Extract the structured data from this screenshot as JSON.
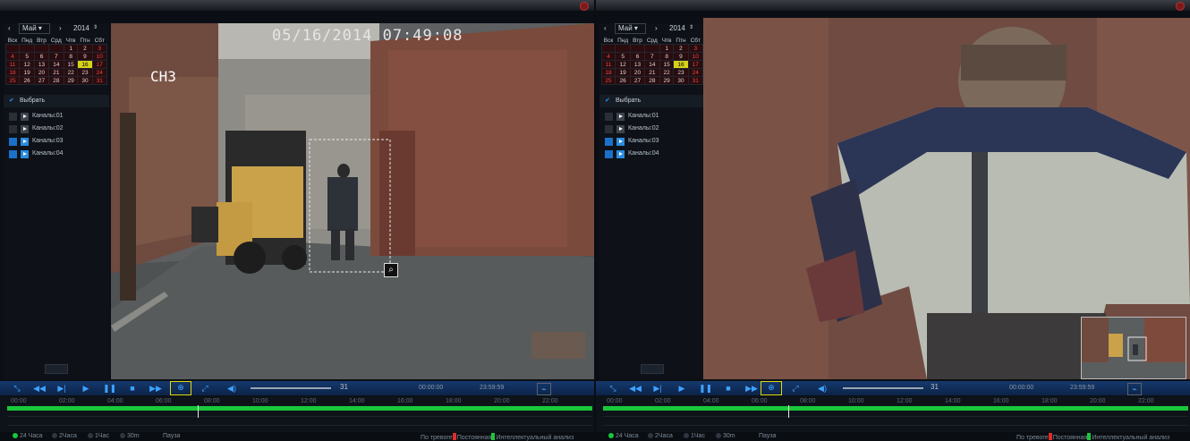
{
  "panes": [
    {
      "calendar": {
        "month": "Май",
        "year": "2014",
        "weekdays": [
          "Вск",
          "Пнд",
          "Втр",
          "Срд",
          "Чтв",
          "Птн",
          "Сбт"
        ],
        "weeks": [
          [
            "",
            "",
            "",
            "",
            "1",
            "2",
            "3"
          ],
          [
            "4",
            "5",
            "6",
            "7",
            "8",
            "9",
            "10"
          ],
          [
            "11",
            "12",
            "13",
            "14",
            "15",
            "16",
            "17"
          ],
          [
            "18",
            "19",
            "20",
            "21",
            "22",
            "23",
            "24"
          ],
          [
            "25",
            "26",
            "27",
            "28",
            "29",
            "30",
            "31"
          ]
        ],
        "selected_day": "16"
      },
      "select_label": "Выбрать",
      "channels": [
        {
          "label": "Каналы:01",
          "checked": false
        },
        {
          "label": "Каналы:02",
          "checked": false
        },
        {
          "label": "Каналы:03",
          "checked": true
        },
        {
          "label": "Каналы:04",
          "checked": true
        }
      ],
      "video": {
        "timestamp": "05/16/2014 07:49:08",
        "channel": "CH3"
      },
      "volume": "31",
      "time_start": "00:00:00",
      "time_end": "23:59:59",
      "timeline_ticks": [
        "00:00",
        "02:00",
        "04:00",
        "06:00",
        "08:00",
        "10:00",
        "12:00",
        "14:00",
        "16:00",
        "18:00",
        "20:00",
        "22:00"
      ],
      "range_options": [
        "24 Часа",
        "2Часа",
        "1Час",
        "30m"
      ],
      "pause_label": "Пауза",
      "legend": [
        "По тревоге",
        "Постоянная",
        "Интеллектуальный анализ"
      ]
    },
    {
      "calendar": {
        "month": "Май",
        "year": "2014",
        "weekdays": [
          "Вск",
          "Пнд",
          "Втр",
          "Срд",
          "Чтв",
          "Птн",
          "Сбт"
        ],
        "weeks": [
          [
            "",
            "",
            "",
            "",
            "1",
            "2",
            "3"
          ],
          [
            "4",
            "5",
            "6",
            "7",
            "8",
            "9",
            "10"
          ],
          [
            "11",
            "12",
            "13",
            "14",
            "15",
            "16",
            "17"
          ],
          [
            "18",
            "19",
            "20",
            "21",
            "22",
            "23",
            "24"
          ],
          [
            "25",
            "26",
            "27",
            "28",
            "29",
            "30",
            "31"
          ]
        ],
        "selected_day": "16"
      },
      "select_label": "Выбрать",
      "channels": [
        {
          "label": "Каналы:01",
          "checked": false
        },
        {
          "label": "Каналы:02",
          "checked": false
        },
        {
          "label": "Каналы:03",
          "checked": true
        },
        {
          "label": "Каналы:04",
          "checked": true
        }
      ],
      "volume": "31",
      "time_start": "00:00:00",
      "time_end": "23:59:59",
      "timeline_ticks": [
        "00:00",
        "02:00",
        "04:00",
        "06:00",
        "08:00",
        "10:00",
        "12:00",
        "14:00",
        "16:00",
        "18:00",
        "20:00",
        "22:00"
      ],
      "range_options": [
        "24 Часа",
        "2Часа",
        "1Час",
        "30m"
      ],
      "pause_label": "Пауза",
      "legend": [
        "По тревоге",
        "Постоянная",
        "Интеллектуальный анализ"
      ]
    }
  ],
  "colors": {
    "accent": "#1f6fd1",
    "timeline_green": "#19c83a",
    "highlight": "#e0d80e",
    "alarm_red": "#e02c2c"
  },
  "icons": [
    "close-icon",
    "rewind-icon",
    "step-icon",
    "play-icon",
    "pause-icon",
    "stop-icon",
    "fast-forward-icon",
    "zoom-icon",
    "fit-icon",
    "volume-icon",
    "waveform-icon",
    "list-icon",
    "magnifier-icon"
  ]
}
